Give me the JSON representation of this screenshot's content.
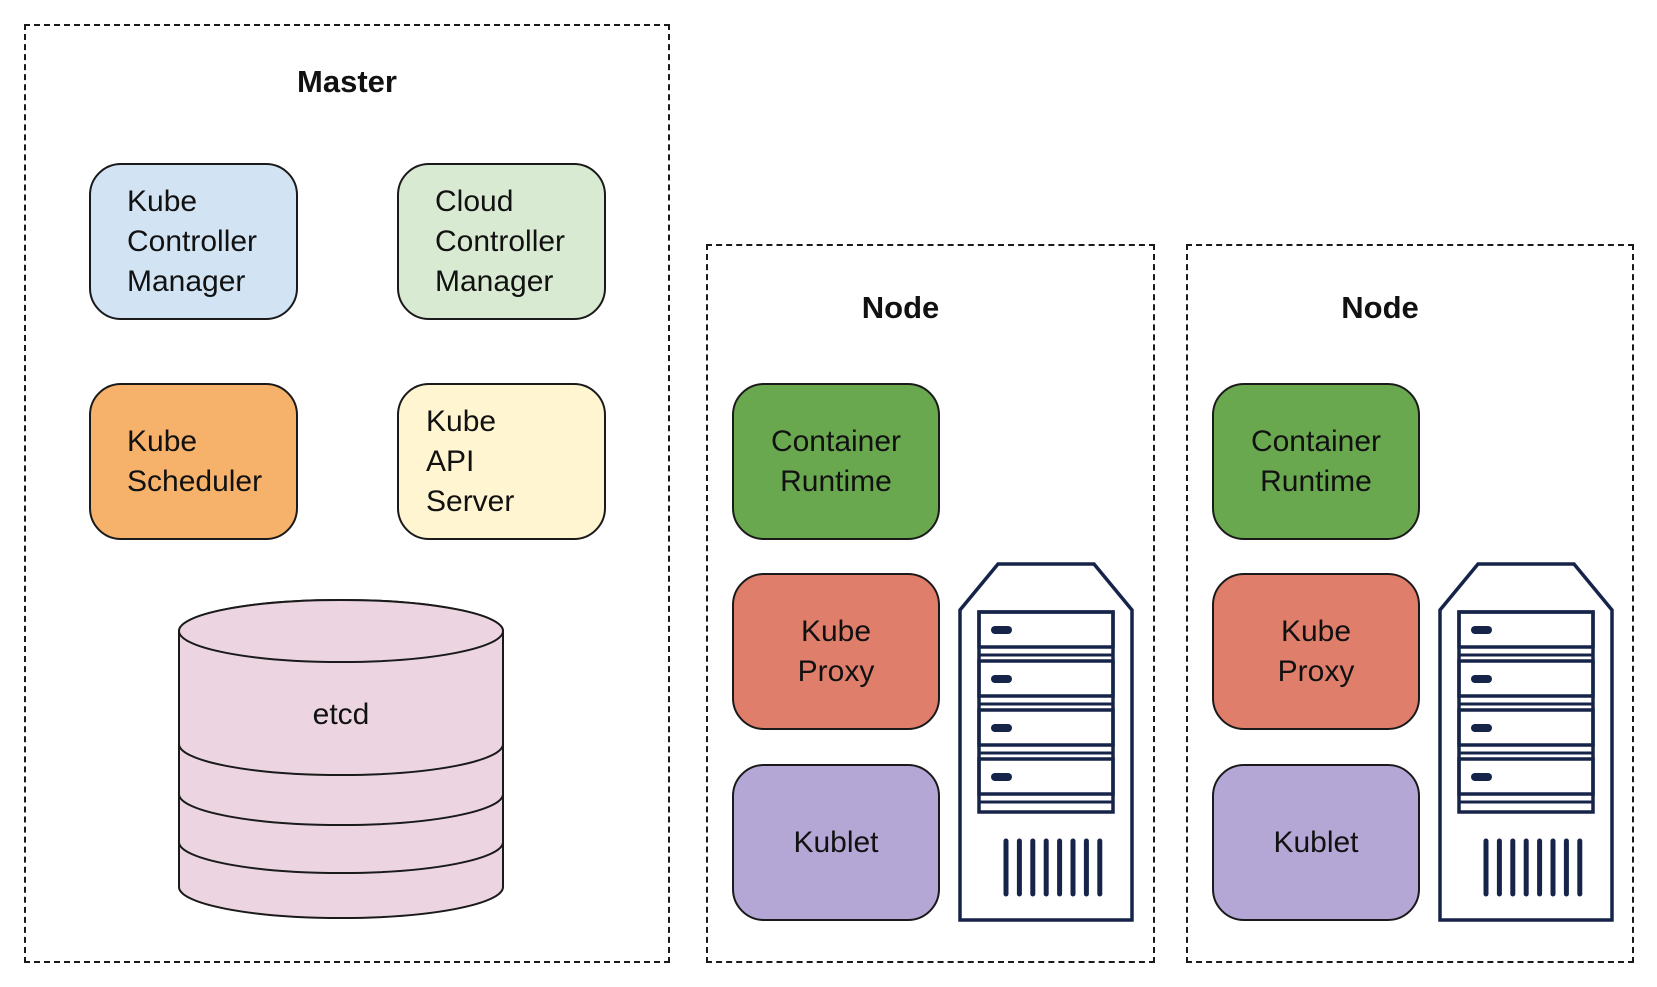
{
  "master": {
    "title": "Master",
    "components": [
      {
        "id": "kube-controller-manager",
        "lines": [
          "Kube",
          "Controller",
          "Manager"
        ],
        "color": "#d2e4f4"
      },
      {
        "id": "cloud-controller-manager",
        "lines": [
          "Cloud",
          "Controller",
          "Manager"
        ],
        "color": "#d9ead3"
      },
      {
        "id": "kube-scheduler",
        "lines": [
          "Kube",
          "Scheduler"
        ],
        "color": "#f6b26b"
      },
      {
        "id": "kube-api-server",
        "lines": [
          "Kube",
          "API",
          "Server"
        ],
        "color": "#fff6d1"
      }
    ],
    "datastore": {
      "label": "etcd",
      "color": "#ecd5e1"
    }
  },
  "nodes": [
    {
      "title": "Node",
      "components": [
        {
          "id": "container-runtime",
          "lines": [
            "Container",
            "Runtime"
          ],
          "color": "#6aa84f"
        },
        {
          "id": "kube-proxy",
          "lines": [
            "Kube",
            "Proxy"
          ],
          "color": "#df7e6a"
        },
        {
          "id": "kublet",
          "lines": [
            "Kublet"
          ],
          "color": "#b4a7d6"
        }
      ],
      "icon": "server-icon"
    },
    {
      "title": "Node",
      "components": [
        {
          "id": "container-runtime",
          "lines": [
            "Container",
            "Runtime"
          ],
          "color": "#6aa84f"
        },
        {
          "id": "kube-proxy",
          "lines": [
            "Kube",
            "Proxy"
          ],
          "color": "#df7e6a"
        },
        {
          "id": "kublet",
          "lines": [
            "Kublet"
          ],
          "color": "#b4a7d6"
        }
      ],
      "icon": "server-icon"
    }
  ],
  "colors": {
    "server_stroke": "#16244a",
    "border": "#1a1a1a"
  }
}
